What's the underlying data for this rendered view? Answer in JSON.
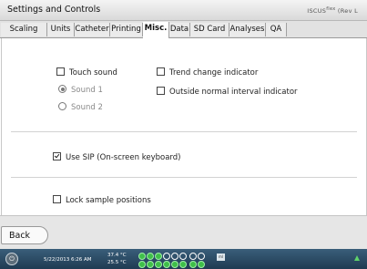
{
  "window": {
    "title": "Settings and Controls",
    "brand": "ISCUS",
    "brand_sup": "flex",
    "brand_suffix": "(Rev L"
  },
  "tabs": [
    {
      "label": "Scaling"
    },
    {
      "label": "Units"
    },
    {
      "label": "Catheter"
    },
    {
      "label": "Printing"
    },
    {
      "label": "Misc.",
      "active": true
    },
    {
      "label": "Data"
    },
    {
      "label": "SD Card"
    },
    {
      "label": "Analyses"
    },
    {
      "label": "QA"
    }
  ],
  "misc": {
    "touch_sound": {
      "label": "Touch sound",
      "checked": false
    },
    "sound1": {
      "label": "Sound 1",
      "selected": true,
      "enabled": false
    },
    "sound2": {
      "label": "Sound 2",
      "selected": false,
      "enabled": false
    },
    "trend_change": {
      "label": "Trend change indicator",
      "checked": false
    },
    "outside_normal": {
      "label": "Outside normal interval indicator",
      "checked": false
    },
    "use_sip": {
      "label": "Use SIP (On-screen keyboard)",
      "checked": true
    },
    "lock_samples": {
      "label": "Lock sample positions",
      "checked": false
    }
  },
  "footer": {
    "back_label": "Back"
  },
  "statusbar": {
    "datetime": "5/22/2013 6:26 AM",
    "temp1": "37.4 °C",
    "temp2": "25.5 °C",
    "mini_icon_label": "ml"
  },
  "colors": {
    "indicator_on": "#3fbf4a",
    "statusbar": "#2b4a63"
  }
}
